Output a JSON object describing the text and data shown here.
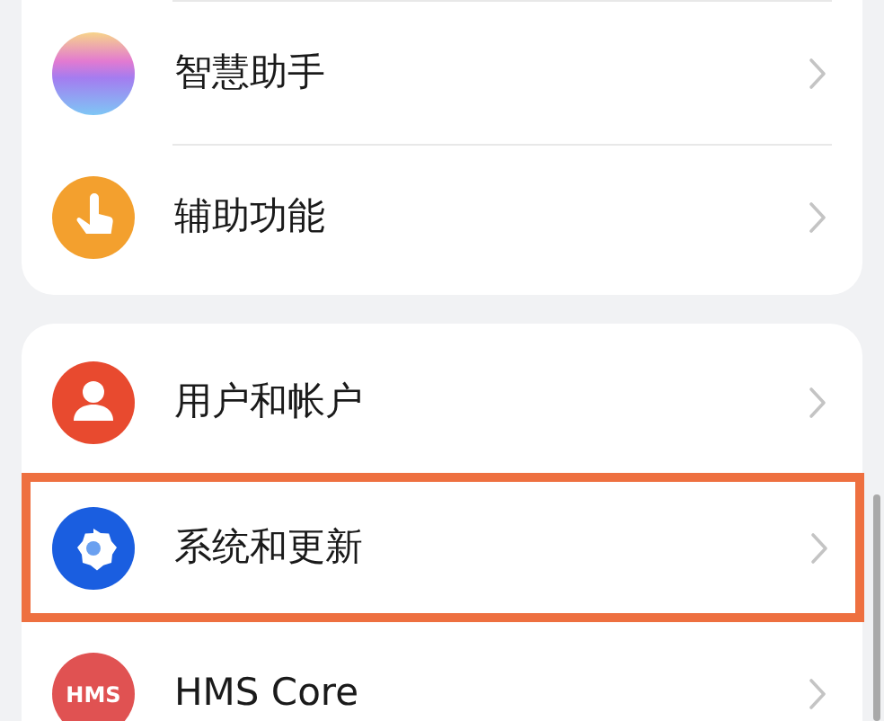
{
  "groups": [
    {
      "items": [
        {
          "label": "智慧助手",
          "kind": "assistant",
          "highlighted": false
        },
        {
          "label": "辅助功能",
          "kind": "accessibility",
          "highlighted": false
        }
      ]
    },
    {
      "items": [
        {
          "label": "用户和帐户",
          "kind": "user",
          "highlighted": false
        },
        {
          "label": "系统和更新",
          "kind": "settings",
          "highlighted": true
        },
        {
          "label": "HMS Core",
          "kind": "hms",
          "icon_label": "HMS",
          "highlighted": false
        }
      ]
    }
  ]
}
